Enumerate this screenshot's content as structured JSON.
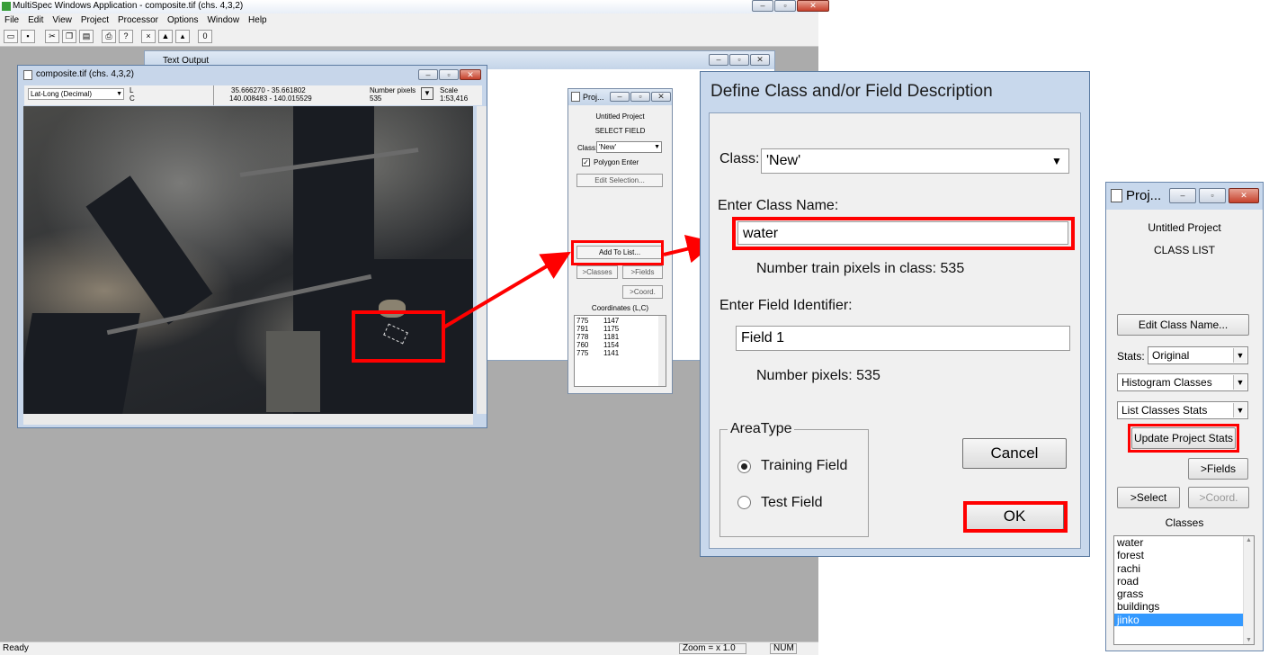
{
  "app": {
    "title": "MultiSpec Windows Application - composite.tif (chs. 4,3,2)",
    "menu": [
      "File",
      "Edit",
      "View",
      "Project",
      "Processor",
      "Options",
      "Window",
      "Help"
    ],
    "status": {
      "left": "Ready",
      "zoom": "Zoom = x  1.0",
      "num": "NUM"
    }
  },
  "text_output": {
    "title": "Text Output"
  },
  "image_window": {
    "title": "composite.tif (chs. 4,3,2)",
    "coord_mode": "Lat-Long (Decimal)",
    "lc_label_l": "L",
    "lc_label_c": "C",
    "lat_range": "35.666270 - 35.661802",
    "lon_range": "140.008483 - 140.015529",
    "number_pixels_label": "Number pixels",
    "number_pixels_value": "535",
    "scale_label": "Scale",
    "scale_value": "1:53,416"
  },
  "project_small": {
    "title": "Proj...",
    "project_name": "Untitled Project",
    "mode": "SELECT FIELD",
    "class_label": "Class:",
    "class_value": "'New'",
    "polygon_enter": "Polygon Enter",
    "edit_selection": "Edit Selection...",
    "add_to_list": "Add To List...",
    "classes_btn": ">Classes",
    "fields_btn": ">Fields",
    "coord_btn": ">Coord.",
    "coords_label": "Coordinates (L,C)",
    "coords": [
      {
        "l": "775",
        "c": "1147"
      },
      {
        "l": "791",
        "c": "1175"
      },
      {
        "l": "778",
        "c": "1181"
      },
      {
        "l": "760",
        "c": "1154"
      },
      {
        "l": "775",
        "c": "1141"
      }
    ]
  },
  "dialog": {
    "title": "Define Class and/or Field Description",
    "class_label": "Class:",
    "class_value": "'New'",
    "enter_class_name_label": "Enter Class Name:",
    "class_name_value": "water",
    "train_pixels_text": "Number train pixels in class: 535",
    "enter_field_label": "Enter Field Identifier:",
    "field_value": "Field 1",
    "number_pixels_text": "Number pixels: 535",
    "area_type_label": "AreaType",
    "training_field": "Training Field",
    "test_field": "Test Field",
    "area_type_selected": "Training Field",
    "cancel": "Cancel",
    "ok": "OK"
  },
  "project_big": {
    "title": "Proj...",
    "project_name": "Untitled Project",
    "mode": "CLASS LIST",
    "edit_class_name": "Edit Class Name...",
    "stats_label": "Stats:",
    "stats_value": "Original",
    "histogram_value": "Histogram Classes",
    "list_stats_value": "List Classes Stats",
    "update_stats": "Update Project Stats",
    "fields_btn": ">Fields",
    "select_btn": ">Select",
    "coord_btn": ">Coord.",
    "classes_label": "Classes",
    "classes": [
      "water",
      "forest",
      "rachi",
      "road",
      "grass",
      "buildings",
      "jinko"
    ],
    "selected_class": "jinko"
  },
  "colors": {
    "highlight": "#ff0000",
    "selection": "#3399ff"
  }
}
